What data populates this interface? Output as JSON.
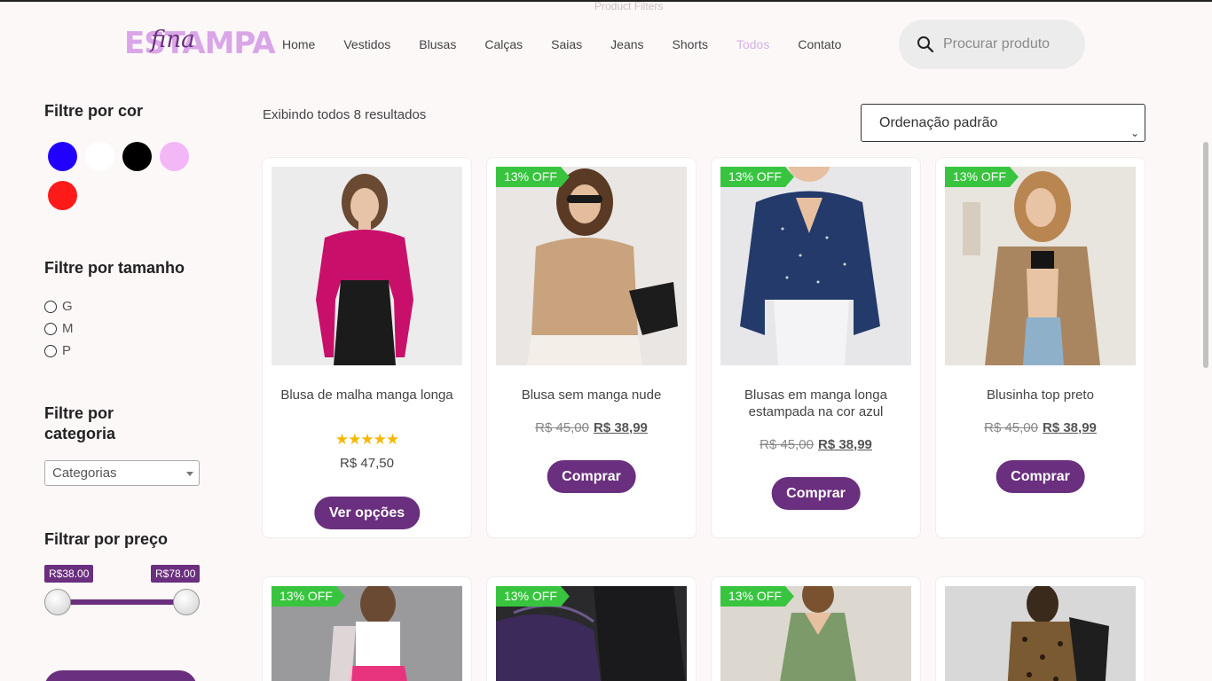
{
  "page": {
    "ghost_title": "Product Filters"
  },
  "header": {
    "logo_word": "ESTAMPA",
    "logo_script": "fina",
    "nav": [
      "Home",
      "Vestidos",
      "Blusas",
      "Calças",
      "Saias",
      "Jeans",
      "Shorts",
      "Todos",
      "Contato"
    ],
    "active_nav": "Todos",
    "search_placeholder": "Procurar produto"
  },
  "sidebar": {
    "color_title": "Filtre por cor",
    "colors": [
      "#2200ff",
      "#ffffff",
      "#000000",
      "#f3b6f7",
      "#ff1a1a"
    ],
    "size_title": "Filtre por tamanho",
    "sizes": [
      "G",
      "M",
      "P"
    ],
    "category_title_1": "Filtre por",
    "category_title_2": "categoria",
    "category_select": "Categorias",
    "price_title": "Filtrar por preço",
    "price_min": "R$38.00",
    "price_max": "R$78.00"
  },
  "main": {
    "results_text": "Exibindo todos 8 resultados",
    "sort_label": "Ordenação padrão",
    "products": [
      {
        "title": "Blusa de malha manga longa",
        "badge": "",
        "stars": "★★★★★",
        "price": "R$ 47,50",
        "old_price": "",
        "new_price": "",
        "button": "Ver opções"
      },
      {
        "title": "Blusa sem manga nude",
        "badge": "13% OFF",
        "stars": "",
        "price": "",
        "old_price": "R$ 45,00",
        "new_price": "R$ 38,99",
        "button": "Comprar"
      },
      {
        "title": "Blusas em manga longa estampada na cor azul",
        "badge": "13% OFF",
        "stars": "",
        "price": "",
        "old_price": "R$ 45,00",
        "new_price": "R$ 38,99",
        "button": "Comprar"
      },
      {
        "title": "Blusinha top preto",
        "badge": "13% OFF",
        "stars": "",
        "price": "",
        "old_price": "R$ 45,00",
        "new_price": "R$ 38,99",
        "button": "Comprar"
      }
    ],
    "row2_badges": [
      "13% OFF",
      "13% OFF",
      "13% OFF",
      ""
    ]
  }
}
